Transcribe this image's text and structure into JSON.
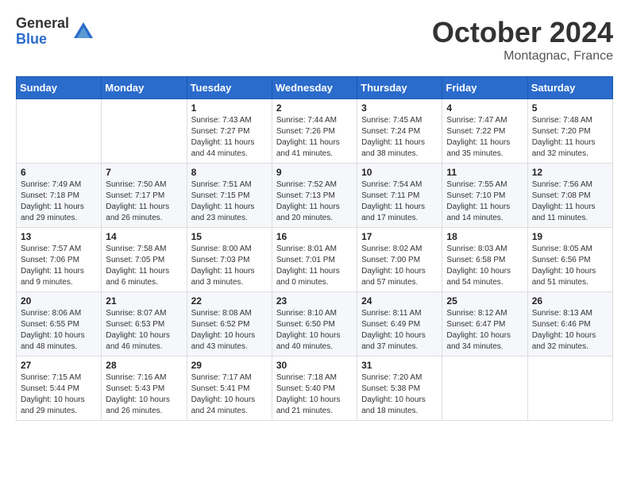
{
  "header": {
    "logo_general": "General",
    "logo_blue": "Blue",
    "month_year": "October 2024",
    "location": "Montagnac, France"
  },
  "days_of_week": [
    "Sunday",
    "Monday",
    "Tuesday",
    "Wednesday",
    "Thursday",
    "Friday",
    "Saturday"
  ],
  "weeks": [
    [
      {
        "day": null,
        "info": null
      },
      {
        "day": null,
        "info": null
      },
      {
        "day": "1",
        "info": "Sunrise: 7:43 AM\nSunset: 7:27 PM\nDaylight: 11 hours and 44 minutes."
      },
      {
        "day": "2",
        "info": "Sunrise: 7:44 AM\nSunset: 7:26 PM\nDaylight: 11 hours and 41 minutes."
      },
      {
        "day": "3",
        "info": "Sunrise: 7:45 AM\nSunset: 7:24 PM\nDaylight: 11 hours and 38 minutes."
      },
      {
        "day": "4",
        "info": "Sunrise: 7:47 AM\nSunset: 7:22 PM\nDaylight: 11 hours and 35 minutes."
      },
      {
        "day": "5",
        "info": "Sunrise: 7:48 AM\nSunset: 7:20 PM\nDaylight: 11 hours and 32 minutes."
      }
    ],
    [
      {
        "day": "6",
        "info": "Sunrise: 7:49 AM\nSunset: 7:18 PM\nDaylight: 11 hours and 29 minutes."
      },
      {
        "day": "7",
        "info": "Sunrise: 7:50 AM\nSunset: 7:17 PM\nDaylight: 11 hours and 26 minutes."
      },
      {
        "day": "8",
        "info": "Sunrise: 7:51 AM\nSunset: 7:15 PM\nDaylight: 11 hours and 23 minutes."
      },
      {
        "day": "9",
        "info": "Sunrise: 7:52 AM\nSunset: 7:13 PM\nDaylight: 11 hours and 20 minutes."
      },
      {
        "day": "10",
        "info": "Sunrise: 7:54 AM\nSunset: 7:11 PM\nDaylight: 11 hours and 17 minutes."
      },
      {
        "day": "11",
        "info": "Sunrise: 7:55 AM\nSunset: 7:10 PM\nDaylight: 11 hours and 14 minutes."
      },
      {
        "day": "12",
        "info": "Sunrise: 7:56 AM\nSunset: 7:08 PM\nDaylight: 11 hours and 11 minutes."
      }
    ],
    [
      {
        "day": "13",
        "info": "Sunrise: 7:57 AM\nSunset: 7:06 PM\nDaylight: 11 hours and 9 minutes."
      },
      {
        "day": "14",
        "info": "Sunrise: 7:58 AM\nSunset: 7:05 PM\nDaylight: 11 hours and 6 minutes."
      },
      {
        "day": "15",
        "info": "Sunrise: 8:00 AM\nSunset: 7:03 PM\nDaylight: 11 hours and 3 minutes."
      },
      {
        "day": "16",
        "info": "Sunrise: 8:01 AM\nSunset: 7:01 PM\nDaylight: 11 hours and 0 minutes."
      },
      {
        "day": "17",
        "info": "Sunrise: 8:02 AM\nSunset: 7:00 PM\nDaylight: 10 hours and 57 minutes."
      },
      {
        "day": "18",
        "info": "Sunrise: 8:03 AM\nSunset: 6:58 PM\nDaylight: 10 hours and 54 minutes."
      },
      {
        "day": "19",
        "info": "Sunrise: 8:05 AM\nSunset: 6:56 PM\nDaylight: 10 hours and 51 minutes."
      }
    ],
    [
      {
        "day": "20",
        "info": "Sunrise: 8:06 AM\nSunset: 6:55 PM\nDaylight: 10 hours and 48 minutes."
      },
      {
        "day": "21",
        "info": "Sunrise: 8:07 AM\nSunset: 6:53 PM\nDaylight: 10 hours and 46 minutes."
      },
      {
        "day": "22",
        "info": "Sunrise: 8:08 AM\nSunset: 6:52 PM\nDaylight: 10 hours and 43 minutes."
      },
      {
        "day": "23",
        "info": "Sunrise: 8:10 AM\nSunset: 6:50 PM\nDaylight: 10 hours and 40 minutes."
      },
      {
        "day": "24",
        "info": "Sunrise: 8:11 AM\nSunset: 6:49 PM\nDaylight: 10 hours and 37 minutes."
      },
      {
        "day": "25",
        "info": "Sunrise: 8:12 AM\nSunset: 6:47 PM\nDaylight: 10 hours and 34 minutes."
      },
      {
        "day": "26",
        "info": "Sunrise: 8:13 AM\nSunset: 6:46 PM\nDaylight: 10 hours and 32 minutes."
      }
    ],
    [
      {
        "day": "27",
        "info": "Sunrise: 7:15 AM\nSunset: 5:44 PM\nDaylight: 10 hours and 29 minutes."
      },
      {
        "day": "28",
        "info": "Sunrise: 7:16 AM\nSunset: 5:43 PM\nDaylight: 10 hours and 26 minutes."
      },
      {
        "day": "29",
        "info": "Sunrise: 7:17 AM\nSunset: 5:41 PM\nDaylight: 10 hours and 24 minutes."
      },
      {
        "day": "30",
        "info": "Sunrise: 7:18 AM\nSunset: 5:40 PM\nDaylight: 10 hours and 21 minutes."
      },
      {
        "day": "31",
        "info": "Sunrise: 7:20 AM\nSunset: 5:38 PM\nDaylight: 10 hours and 18 minutes."
      },
      {
        "day": null,
        "info": null
      },
      {
        "day": null,
        "info": null
      }
    ]
  ]
}
